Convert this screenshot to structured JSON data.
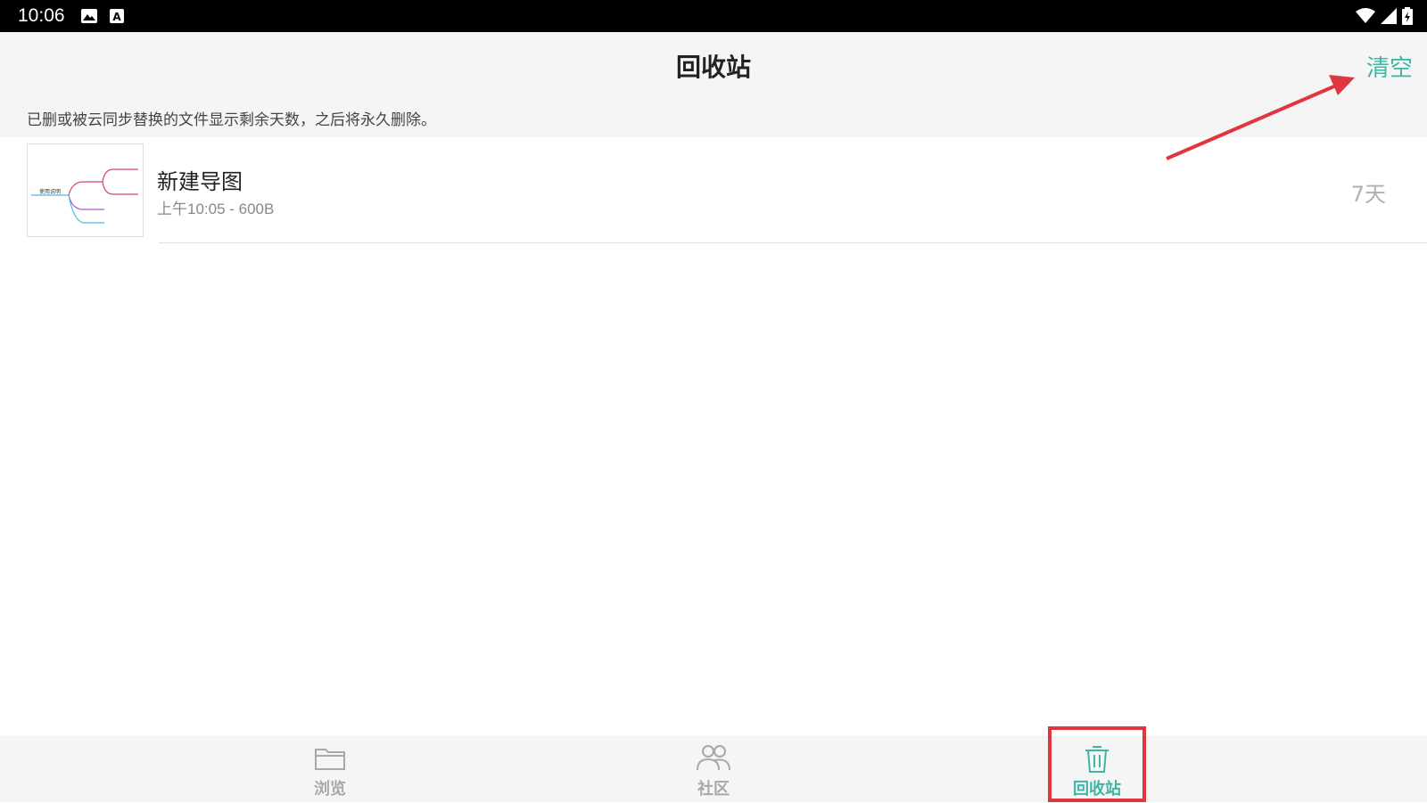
{
  "status_bar": {
    "time": "10:06"
  },
  "header": {
    "title": "回收站",
    "clear_label": "清空"
  },
  "notice": "已删或被云同步替换的文件显示剩余天数，之后将永久删除。",
  "files": [
    {
      "name": "新建导图",
      "meta": "上午10:05 - 600B",
      "days_left": "7天",
      "thumbnail_label": "使用说明"
    }
  ],
  "bottom_nav": {
    "items": [
      {
        "label": "浏览",
        "icon": "folder-icon"
      },
      {
        "label": "社区",
        "icon": "people-icon"
      },
      {
        "label": "回收站",
        "icon": "trash-icon"
      }
    ],
    "active_index": 2
  },
  "colors": {
    "accent": "#3fb5a3",
    "annotation": "#e0363f",
    "header_bg": "#f5f5f5"
  }
}
